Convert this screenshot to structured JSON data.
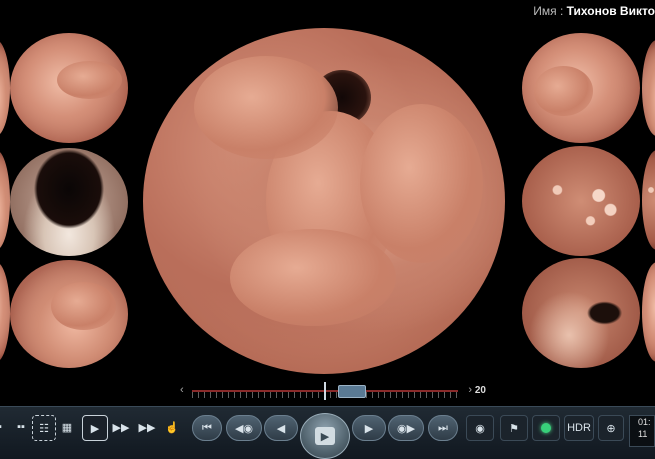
{
  "header": {
    "patient_label": "Имя :",
    "patient_name": "Тихонов Викто"
  },
  "timeline": {
    "end_value": "20",
    "left_arrow": "‹",
    "right_arrow": "›",
    "position_fraction": 0.52
  },
  "toolbar": {
    "layout_2x2": "▪▪",
    "layout_list": "☷",
    "layout_grid": "▦",
    "play_small": "▶",
    "fast_forward": "▶▶",
    "step_frames": "▶▶",
    "hand": "☝",
    "first_frame": "⏮",
    "prev_camera": "◀◉",
    "prev": "◀",
    "play": "▶",
    "next": "▶",
    "next_camera": "◉▶",
    "last_frame": "⏭",
    "snapshot": "◉",
    "flag": "⚑",
    "hdr": "HDR",
    "zoom": "⊕",
    "clock_line1": "01:",
    "clock_line2": "11"
  },
  "colors": {
    "accent": "#38d07a",
    "timeline_track": "#8a2a2a",
    "toolbar_bg": "#1b232b"
  }
}
